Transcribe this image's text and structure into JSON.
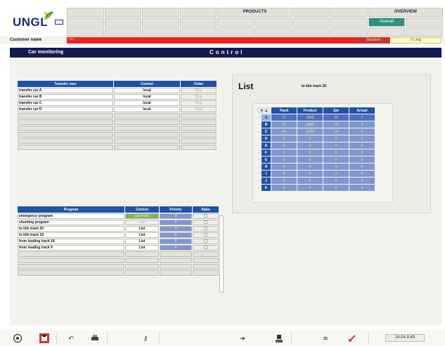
{
  "brand": {
    "logo_text": "UNGL"
  },
  "header": {
    "products_label": "PRODUCTS",
    "overview_label": "OVERVIEW",
    "overview_button": "Overall"
  },
  "customer": {
    "label": "Customer name",
    "value": "xxx",
    "status": "Standard",
    "user": "0  Lingl"
  },
  "nav": {
    "section": "Car monitoring",
    "title": "Control"
  },
  "transfer_table": {
    "headers": [
      "Transfer cars",
      "Control",
      "Order"
    ],
    "rows": [
      {
        "name": "transfer car A",
        "control": "local",
        "order": "Stop"
      },
      {
        "name": "transfer car B",
        "control": "local",
        "order": "Stop"
      },
      {
        "name": "transfer car C",
        "control": "local",
        "order": "Stop"
      },
      {
        "name": "transfer car D",
        "control": "local",
        "order": "Stop"
      }
    ]
  },
  "program_table": {
    "headers": [
      "Program",
      "Control",
      "Priority",
      "State"
    ],
    "rows": [
      {
        "name": "emergency program",
        "control": "automatic",
        "priority": "0"
      },
      {
        "name": "shunting program",
        "control": "List",
        "priority": "0"
      },
      {
        "name": "to kiln track 20",
        "control": "List",
        "priority": "0"
      },
      {
        "name": "to kiln track 19",
        "control": "List",
        "priority": "0"
      },
      {
        "name": "from loading track 18",
        "control": "List",
        "priority": "0"
      },
      {
        "name": "from loading track 9",
        "control": "List",
        "priority": "0"
      }
    ]
  },
  "list_panel": {
    "title": "List",
    "subtitle": "to kiln track 20",
    "headers": [
      "Track",
      "Product",
      "Set",
      "Actual"
    ],
    "rows": [
      {
        "label": "A",
        "track": "17",
        "product": "1049",
        "set": "10",
        "actual": "7"
      },
      {
        "label": "B",
        "track": "19",
        "product": "1049",
        "set": "10",
        "actual": "0"
      },
      {
        "label": "C",
        "track": "20",
        "product": "2149",
        "set": "10",
        "actual": "0"
      },
      {
        "label": "D",
        "track": "0",
        "product": "0",
        "set": "0",
        "actual": "0"
      },
      {
        "label": "E",
        "track": "0",
        "product": "0",
        "set": "0",
        "actual": "0"
      },
      {
        "label": "F",
        "track": "0",
        "product": "0",
        "set": "0",
        "actual": "0"
      },
      {
        "label": "G",
        "track": "0",
        "product": "0",
        "set": "0",
        "actual": "0"
      },
      {
        "label": "H",
        "track": "0",
        "product": "0",
        "set": "0",
        "actual": "0"
      },
      {
        "label": "I",
        "track": "0",
        "product": "0",
        "set": "0",
        "actual": "0"
      },
      {
        "label": "J",
        "track": "0",
        "product": "0",
        "set": "0",
        "actual": "0"
      },
      {
        "label": "K",
        "track": "0",
        "product": "0",
        "set": "0",
        "actual": "0"
      }
    ]
  },
  "toolbar": {
    "clock": "24.04  9.45"
  },
  "colors": {
    "nav_bg": "#131a52",
    "table_header": "#1f52a8",
    "customer_bar": "#e8231f",
    "accent_green": "#2f8f86"
  }
}
